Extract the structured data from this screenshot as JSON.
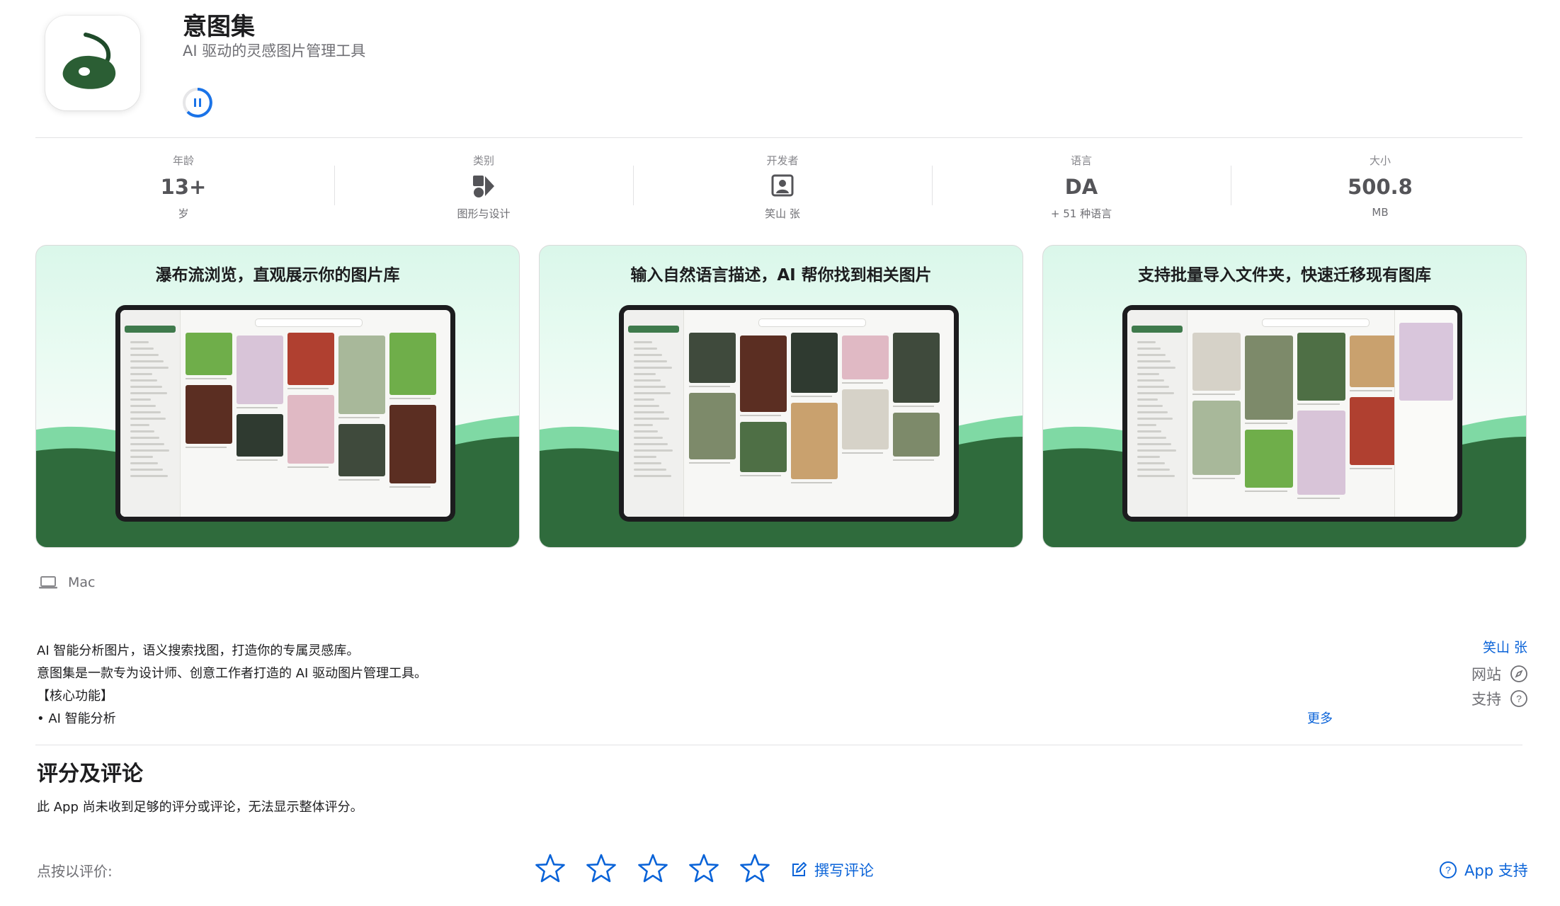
{
  "app": {
    "title": "意图集",
    "subtitle": "AI 驱动的灵感图片管理工具",
    "icon": "brush-leaf-logo",
    "accent_color": "#2b5e34"
  },
  "info": [
    {
      "label": "年龄",
      "value": "13+",
      "sub": "岁"
    },
    {
      "label": "类别",
      "icon": "design-category-icon",
      "sub": "图形与设计"
    },
    {
      "label": "开发者",
      "icon": "developer-icon",
      "sub": "笑山 张"
    },
    {
      "label": "语言",
      "value": "DA",
      "sub": "+ 51 种语言"
    },
    {
      "label": "大小",
      "value": "500.8",
      "sub": "MB"
    }
  ],
  "screenshots": [
    {
      "caption": "瀑布流浏览，直观展示你的图片库"
    },
    {
      "caption": "输入自然语言描述，AI 帮你找到相关图片"
    },
    {
      "caption": "支持批量导入文件夹，快速迁移现有图库"
    }
  ],
  "platform": {
    "label": "Mac",
    "icon": "laptop-icon"
  },
  "description": {
    "lines": [
      "AI 智能分析图片，语义搜索找图，打造你的专属灵感库。",
      "意图集是一款专为设计师、创意工作者打造的 AI 驱动图片管理工具。",
      "【核心功能】",
      "• AI 智能分析"
    ],
    "more": "更多"
  },
  "developer_link": "笑山 张",
  "links": {
    "website": "网站",
    "support": "支持"
  },
  "ratings": {
    "title": "评分及评论",
    "note": "此 App 尚未收到足够的评分或评论，无法显示整体评分。",
    "tap_label": "点按以评价:",
    "write_review": "撰写评论",
    "app_support": "App 支持"
  },
  "colors": {
    "link": "#0a63d8",
    "wave_dark": "#2f6b3c",
    "wave_light": "#7fd9a4"
  }
}
